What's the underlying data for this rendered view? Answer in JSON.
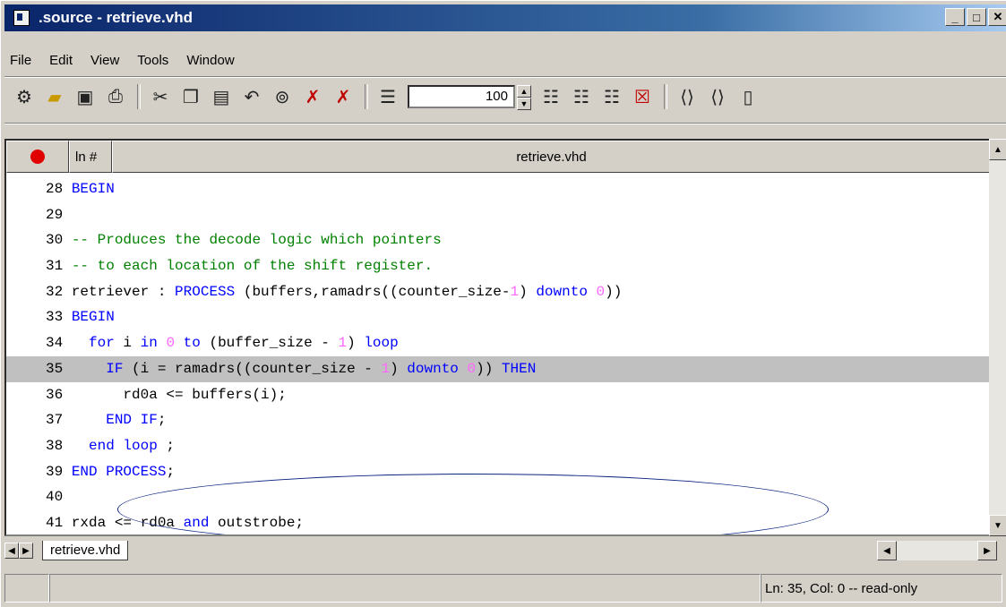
{
  "window": {
    "title": ".source - retrieve.vhd",
    "controls": {
      "minimize": "_",
      "maximize": "□",
      "close": "✕"
    }
  },
  "menu": [
    "File",
    "Edit",
    "View",
    "Tools",
    "Window"
  ],
  "toolbar": {
    "zoom_value": "100",
    "icons": [
      "compile-icon",
      "open-folder-icon",
      "save-icon",
      "print-icon",
      "cut-icon",
      "copy-icon",
      "paste-icon",
      "undo-icon",
      "find-icon",
      "bookmark-prev-icon",
      "bookmark-clear-icon",
      "line-numbers-icon",
      "indent-icon",
      "outdent-icon",
      "comment-icon",
      "clear-icon",
      "expand-icon",
      "collapse-icon",
      "new-file-icon"
    ]
  },
  "editor": {
    "header": {
      "line_col": "ln #",
      "file": "retrieve.vhd"
    },
    "highlighted_line": 35,
    "lines": [
      {
        "n": "28",
        "tokens": [
          {
            "t": " "
          },
          {
            "t": "BEGIN",
            "c": "kw"
          }
        ]
      },
      {
        "n": "29",
        "tokens": [
          {
            "t": ""
          }
        ]
      },
      {
        "n": "30",
        "tokens": [
          {
            "t": " "
          },
          {
            "t": "-- Produces the decode logic which pointers",
            "c": "cm"
          }
        ]
      },
      {
        "n": "31",
        "tokens": [
          {
            "t": " "
          },
          {
            "t": "-- to each location of the shift register.",
            "c": "cm"
          }
        ]
      },
      {
        "n": "32",
        "tokens": [
          {
            "t": " retriever : "
          },
          {
            "t": "PROCESS",
            "c": "kw"
          },
          {
            "t": " (buffers,ramadrs((counter_size-"
          },
          {
            "t": "1",
            "c": "nm"
          },
          {
            "t": ") "
          },
          {
            "t": "downto",
            "c": "kw"
          },
          {
            "t": " "
          },
          {
            "t": "0",
            "c": "nm"
          },
          {
            "t": "))"
          }
        ]
      },
      {
        "n": "33",
        "tokens": [
          {
            "t": " "
          },
          {
            "t": "BEGIN",
            "c": "kw"
          }
        ]
      },
      {
        "n": "34",
        "tokens": [
          {
            "t": "   "
          },
          {
            "t": "for",
            "c": "kw"
          },
          {
            "t": " i "
          },
          {
            "t": "in",
            "c": "kw"
          },
          {
            "t": " "
          },
          {
            "t": "0",
            "c": "nm"
          },
          {
            "t": " "
          },
          {
            "t": "to",
            "c": "kw"
          },
          {
            "t": " (buffer_size - "
          },
          {
            "t": "1",
            "c": "nm"
          },
          {
            "t": ") "
          },
          {
            "t": "loop",
            "c": "kw"
          }
        ]
      },
      {
        "n": "35",
        "tokens": [
          {
            "t": "     "
          },
          {
            "t": "IF",
            "c": "kw"
          },
          {
            "t": " (i = ramadrs((counter_size - "
          },
          {
            "t": "1",
            "c": "nm"
          },
          {
            "t": ") "
          },
          {
            "t": "downto",
            "c": "kw"
          },
          {
            "t": " "
          },
          {
            "t": "0",
            "c": "nm"
          },
          {
            "t": ")) "
          },
          {
            "t": "THEN",
            "c": "kw"
          }
        ]
      },
      {
        "n": "36",
        "tokens": [
          {
            "t": "       rd0a <= buffers(i);"
          }
        ]
      },
      {
        "n": "37",
        "tokens": [
          {
            "t": "     "
          },
          {
            "t": "END IF",
            "c": "kw"
          },
          {
            "t": ";"
          }
        ]
      },
      {
        "n": "38",
        "tokens": [
          {
            "t": "   "
          },
          {
            "t": "end loop",
            "c": "kw"
          },
          {
            "t": " ;"
          }
        ]
      },
      {
        "n": "39",
        "tokens": [
          {
            "t": " "
          },
          {
            "t": "END PROCESS",
            "c": "kw"
          },
          {
            "t": ";"
          }
        ]
      },
      {
        "n": "40",
        "tokens": [
          {
            "t": ""
          }
        ]
      },
      {
        "n": "41",
        "tokens": [
          {
            "t": " rxda <= rd0a "
          },
          {
            "t": "and",
            "c": "kw"
          },
          {
            "t": " outstrobe;"
          }
        ]
      }
    ]
  },
  "tabs": {
    "active": "retrieve.vhd"
  },
  "status": {
    "position": "Ln:  35, Col:  0 -- read-only"
  },
  "colors": {
    "keyword": "#0000ff",
    "comment": "#008000",
    "number": "#ff66ff",
    "highlight": "#c0c0c0",
    "title_bar": "#0a246a"
  }
}
